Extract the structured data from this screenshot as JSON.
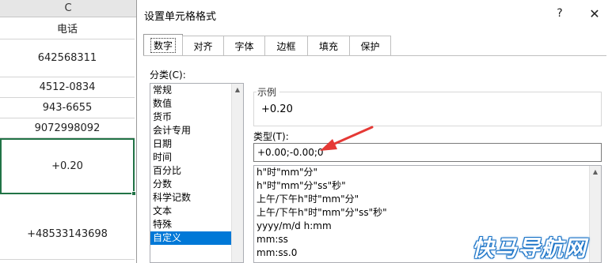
{
  "sheet": {
    "column_header": "C",
    "cells": [
      "电话",
      "642568311",
      "4512-0834",
      "943-6655",
      "9072998092",
      "+0.20",
      "+48533143698"
    ]
  },
  "dialog": {
    "title": "设置单元格格式",
    "help": "?",
    "close": "✕",
    "tabs": [
      "数字",
      "对齐",
      "字体",
      "边框",
      "填充",
      "保护"
    ],
    "category_label": "分类(C):",
    "categories": [
      "常规",
      "数值",
      "货币",
      "会计专用",
      "日期",
      "时间",
      "百分比",
      "分数",
      "科学记数",
      "文本",
      "特殊",
      "自定义"
    ],
    "selected_category": "自定义",
    "sample_label": "示例",
    "sample_value": "+0.20",
    "type_label": "类型(T):",
    "type_value": "+0.00;-0.00;0",
    "formats": [
      "h\"时\"mm\"分\"",
      "h\"时\"mm\"分\"ss\"秒\"",
      "上午/下午h\"时\"mm\"分\"",
      "上午/下午h\"时\"mm\"分\"ss\"秒\"",
      "yyyy/m/d h:mm",
      "mm:ss",
      "mm:ss.0"
    ]
  },
  "watermark": "快马导航网",
  "colors": {
    "accent": "#0078d7",
    "arrow": "#e53935",
    "excel_green": "#217346"
  }
}
